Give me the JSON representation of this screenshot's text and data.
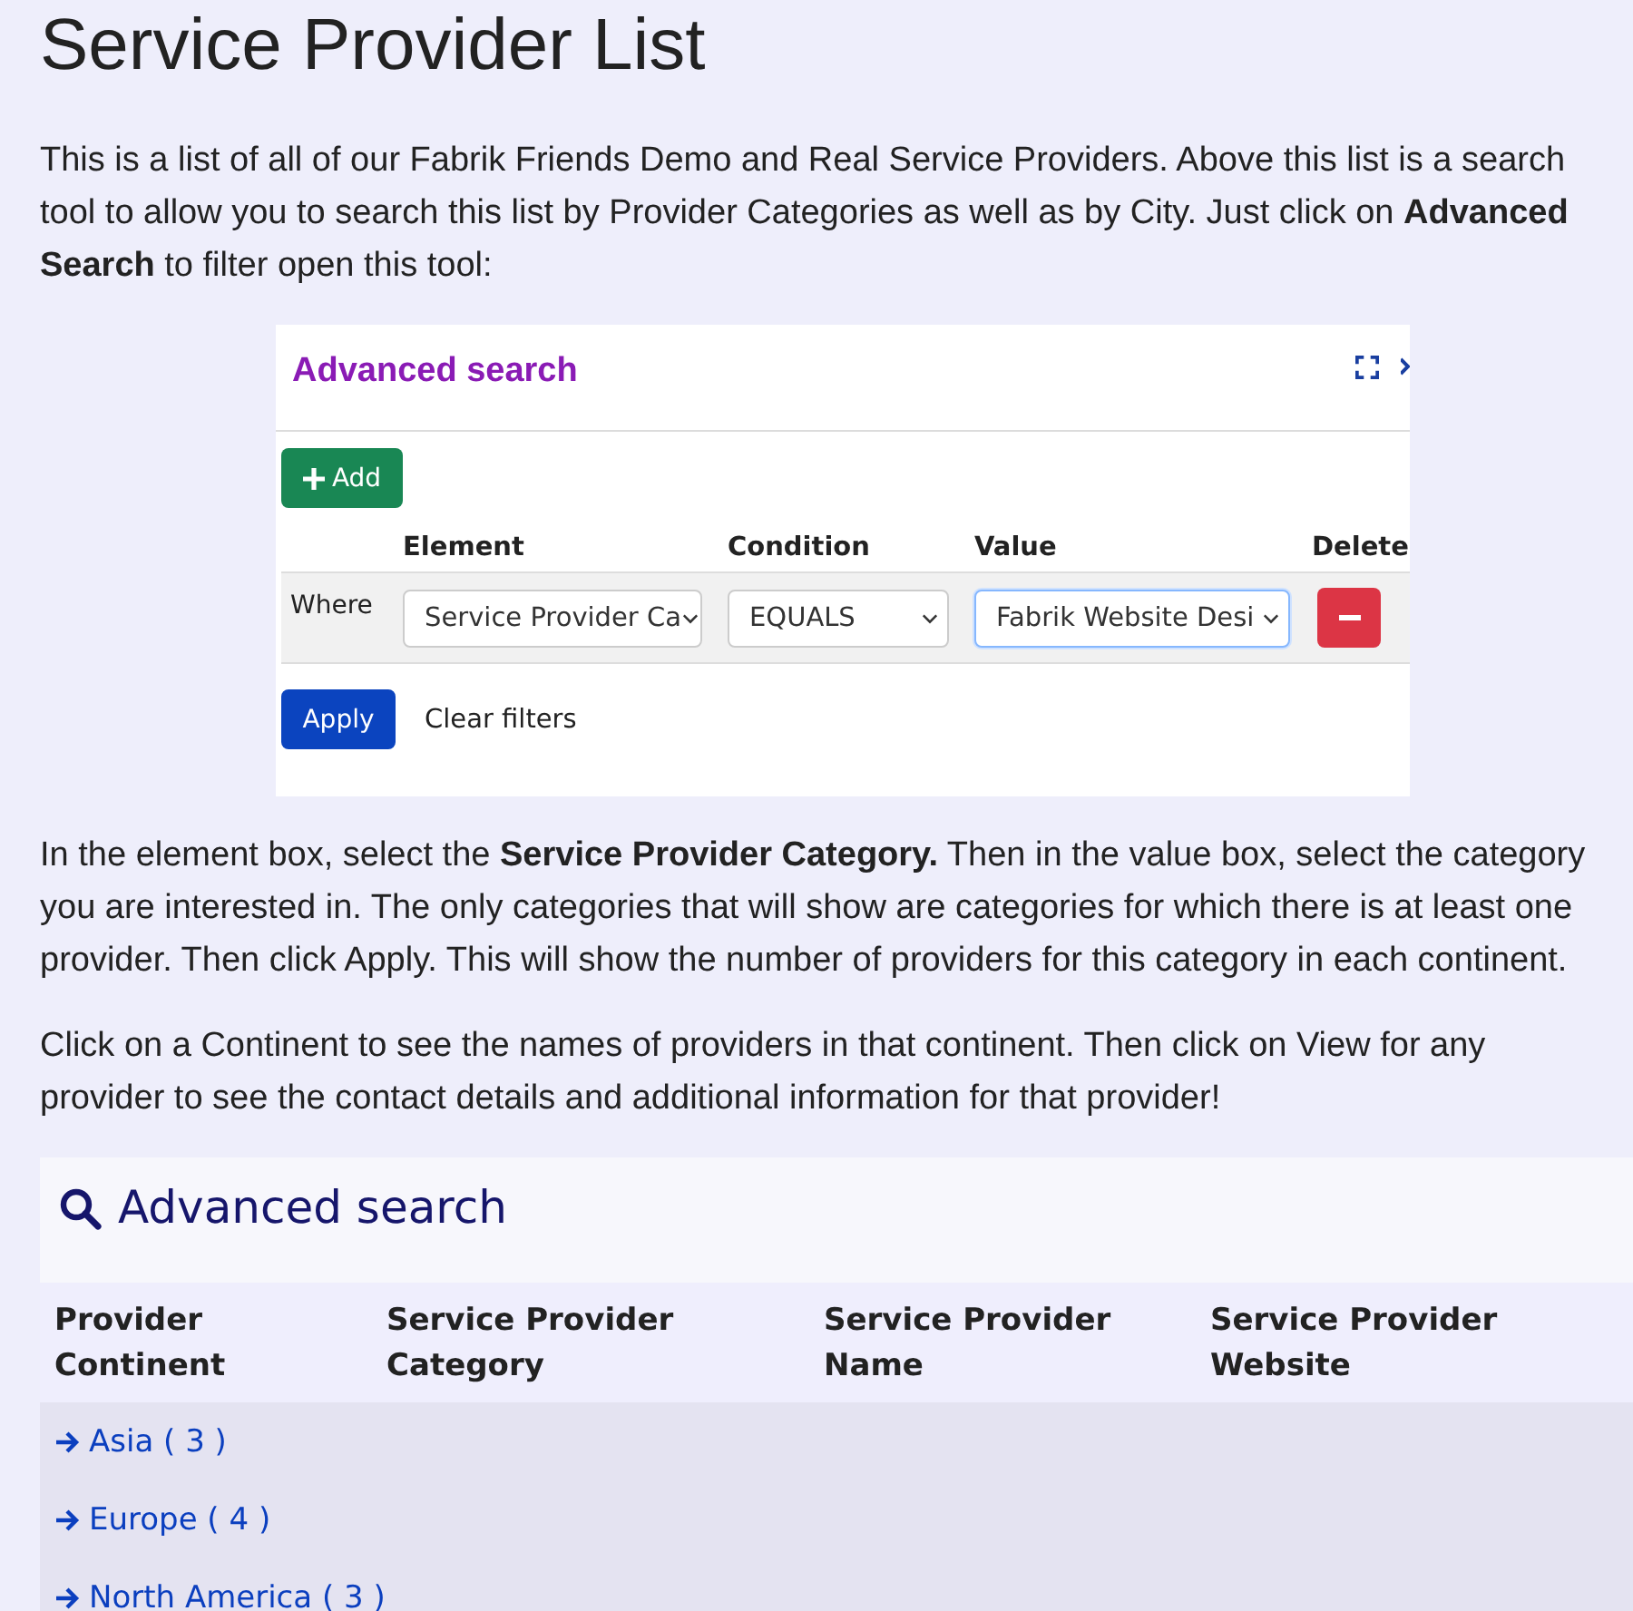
{
  "page_title": "Service Provider List",
  "intro": "This is a list of all of our Fabrik Friends Demo and Real Service Providers. Above this list is a search tool to allow you to search this list by Provider Categories as well as by City. Just click on **Advanced Search** to filter open this tool:",
  "figure": {
    "title": "Advanced search",
    "add_button": "Add",
    "columns": [
      "Element",
      "Condition",
      "Value",
      "Delete"
    ],
    "row": {
      "label": "Where",
      "element": "Service Provider Ca",
      "condition": "EQUALS",
      "value": "Fabrik Website Desi",
      "value_focused": true
    },
    "apply_button": "Apply",
    "clear_button": "Clear filters"
  },
  "paragraphs": [
    "In the element box, select the **Service Provider Category.** Then in the value box, select the category you are interested in. The only categories that will show are categories for which there is at least one provider. Then click Apply. This will show the number of providers for this category in each continent.",
    "Click on a Continent to see the names of providers in that continent. Then click on View for any provider to see the contact details and additional information for that provider!"
  ],
  "search_panel": {
    "title": "Advanced search"
  },
  "table": {
    "columns": [
      "Provider Continent",
      "Service Provider Category",
      "Service Provider Name",
      "Service Provider Website"
    ],
    "rows": [
      {
        "label": "Asia ( 3 )"
      },
      {
        "label": "Europe ( 4 )"
      },
      {
        "label": "North America ( 3 )"
      }
    ]
  }
}
